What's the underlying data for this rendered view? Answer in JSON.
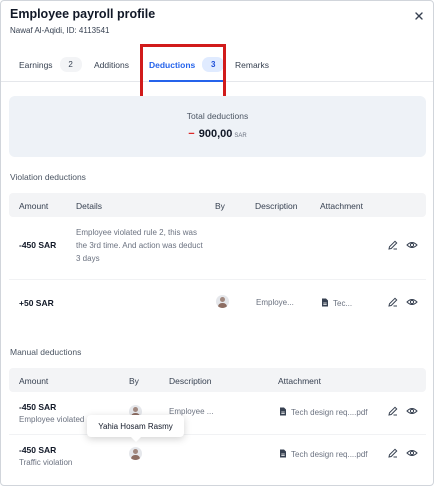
{
  "header": {
    "title": "Employee payroll profile",
    "subtitle": "Nawaf Al-Aqidi, ID: 4113541",
    "close_icon": "close-icon"
  },
  "tabs": [
    {
      "label": "Earnings",
      "count": "2",
      "active": false
    },
    {
      "label": "Additions",
      "count": "",
      "active": false
    },
    {
      "label": "Deductions",
      "count": "3",
      "active": true
    },
    {
      "label": "Remarks",
      "count": "",
      "active": false
    }
  ],
  "total": {
    "label": "Total deductions",
    "sign": "−",
    "value": "900,00",
    "currency": "SAR"
  },
  "violation": {
    "title": "Violation deductions",
    "headers": [
      "Amount",
      "Details",
      "By",
      "Description",
      "Attachment"
    ],
    "rows": [
      {
        "amount": "-450 SAR",
        "details": "Employee violated rule 2, this was the 3rd time. And action was deduct 3 days",
        "by": "",
        "description": "",
        "attachment": ""
      },
      {
        "amount": "+50 SAR",
        "details": "",
        "by": "avatar",
        "description": "Employe...",
        "attachment": "Tec..."
      }
    ]
  },
  "manual": {
    "title": "Manual deductions",
    "headers": [
      "Amount",
      "By",
      "Description",
      "Attachment"
    ],
    "rows": [
      {
        "amount": "-450 SAR",
        "sub": "Employee violated",
        "description": "Employee ...",
        "attachment": "Tech design req....pdf"
      },
      {
        "amount": "-450 SAR",
        "sub": "Traffic violation",
        "description": "",
        "attachment": "Tech design req....pdf"
      }
    ]
  },
  "tooltip": {
    "text": "Yahia Hosam Rasmy"
  },
  "icons": {
    "edit": "edit-icon",
    "view": "eye-icon",
    "file": "file-icon"
  },
  "colors": {
    "accent": "#2563eb",
    "highlight": "#d11b1b",
    "negative": "#dc2626"
  }
}
